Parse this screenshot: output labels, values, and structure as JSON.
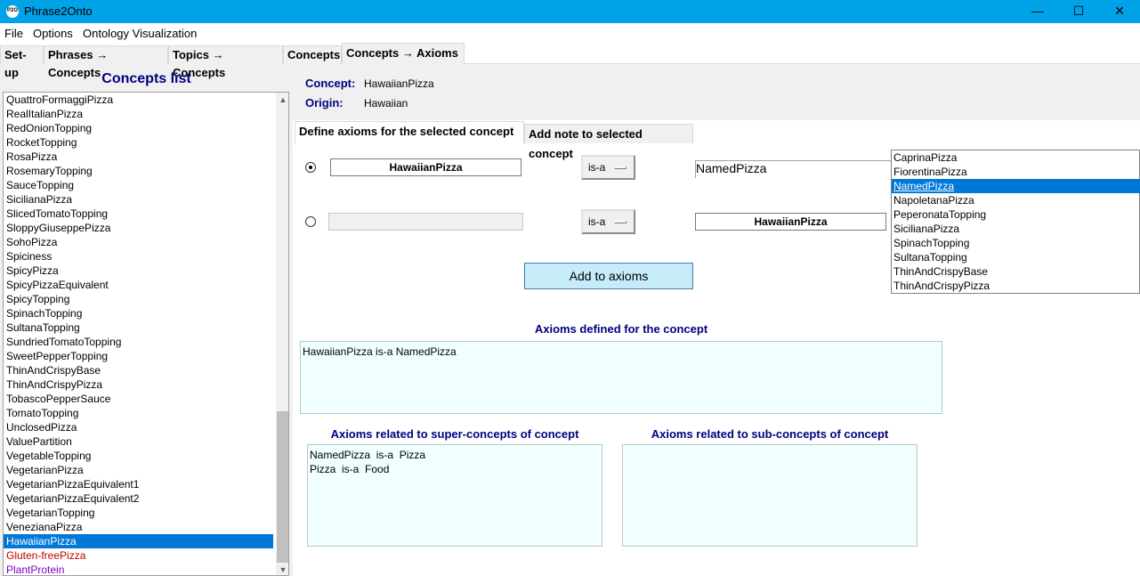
{
  "window": {
    "title": "Phrase2Onto",
    "icon_text": "P2O",
    "minimize": "—",
    "maximize": "☐",
    "close": "✕"
  },
  "menu": [
    "File",
    "Options",
    "Ontology Visualization"
  ],
  "tabs": [
    "Set-up",
    "Phrases → Concepts",
    "Topics → Concepts",
    "Concepts",
    "Concepts → Axioms"
  ],
  "concepts_list": {
    "title": "Concepts list",
    "items": [
      "QuattroFormaggiPizza",
      "RealItalianPizza",
      "RedOnionTopping",
      "RocketTopping",
      "RosaPizza",
      "RosemaryTopping",
      "SauceTopping",
      "SicilianaPizza",
      "SlicedTomatoTopping",
      "SloppyGiuseppePizza",
      "SohoPizza",
      "Spiciness",
      "SpicyPizza",
      "SpicyPizzaEquivalent",
      "SpicyTopping",
      "SpinachTopping",
      "SultanaTopping",
      "SundriedTomatoTopping",
      "SweetPepperTopping",
      "ThinAndCrispyBase",
      "ThinAndCrispyPizza",
      "TobascoPepperSauce",
      "TomatoTopping",
      "UnclosedPizza",
      "ValuePartition",
      "VegetableTopping",
      "VegetarianPizza",
      "VegetarianPizzaEquivalent1",
      "VegetarianPizzaEquivalent2",
      "VegetarianTopping",
      "VenezianaPizza",
      "HawaiianPizza",
      "Gluten-freePizza",
      "PlantProtein"
    ],
    "selected": "HawaiianPizza",
    "colors": {
      "selected_bg": "#0078d7",
      "gluten_free": "#c00000",
      "plant_protein": "#8000c0"
    }
  },
  "concept_info": {
    "concept_label": "Concept:",
    "concept_value": "HawaiianPizza",
    "origin_label": "Origin:",
    "origin_value": "Hawaiian"
  },
  "subtabs": [
    "Define axioms for the selected concept",
    "Add note to selected concept"
  ],
  "axiom_row1": {
    "subject": "HawaiianPizza",
    "relation": "is-a",
    "object": "NamedPizza"
  },
  "axiom_row2": {
    "subject": "",
    "relation": "is-a",
    "object": "HawaiianPizza"
  },
  "object_list": {
    "items": [
      "CaprinaPizza",
      "FiorentinaPizza",
      "NamedPizza",
      "NapoletanaPizza",
      "PeperonataTopping",
      "SicilianaPizza",
      "SpinachTopping",
      "SultanaTopping",
      "ThinAndCrispyBase",
      "ThinAndCrispyPizza"
    ],
    "selected": "NamedPizza"
  },
  "add_button": "Add to axioms",
  "axioms_defined": {
    "title": "Axioms defined for the concept",
    "text": "HawaiianPizza is-a NamedPizza"
  },
  "super_axioms": {
    "title": "Axioms related to super-concepts of concept",
    "text": "NamedPizza  is-a  Pizza\nPizza  is-a  Food"
  },
  "sub_axioms": {
    "title": "Axioms related to sub-concepts of concept",
    "text": ""
  }
}
